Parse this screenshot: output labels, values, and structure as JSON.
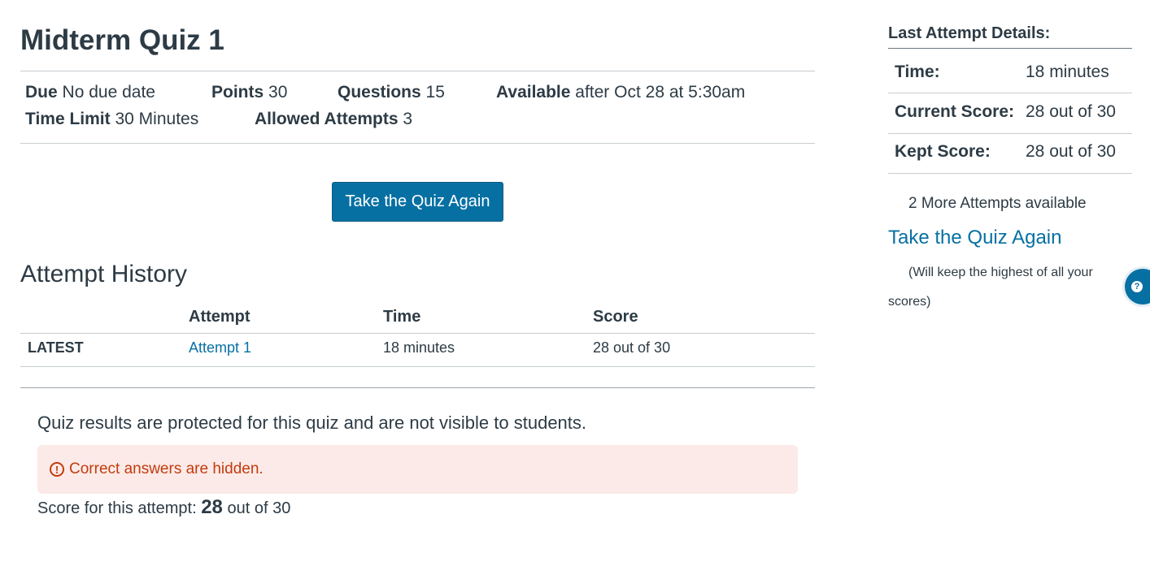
{
  "quiz": {
    "title": "Midterm Quiz 1",
    "due_label": "Due",
    "due_value": "No due date",
    "points_label": "Points",
    "points_value": "30",
    "questions_label": "Questions",
    "questions_value": "15",
    "available_label": "Available",
    "available_value": "after Oct 28 at 5:30am",
    "time_limit_label": "Time Limit",
    "time_limit_value": "30 Minutes",
    "allowed_attempts_label": "Allowed Attempts",
    "allowed_attempts_value": "3",
    "take_again_button": "Take the Quiz Again"
  },
  "attempt_history": {
    "heading": "Attempt History",
    "columns": [
      "",
      "Attempt",
      "Time",
      "Score"
    ],
    "rows": [
      {
        "tag": "LATEST",
        "attempt": "Attempt 1",
        "time": "18 minutes",
        "score": "28 out of 30"
      }
    ]
  },
  "results": {
    "protected_text": "Quiz results are protected for this quiz and are not visible to students.",
    "alert_text": "Correct answers are hidden.",
    "score_prefix": "Score for this attempt:",
    "score_value": "28",
    "score_suffix": "out of 30"
  },
  "sidebar": {
    "title": "Last Attempt Details:",
    "rows": [
      {
        "label": "Time:",
        "value": "18 minutes"
      },
      {
        "label": "Current Score:",
        "value": "28 out of 30"
      },
      {
        "label": "Kept Score:",
        "value": "28 out of 30"
      }
    ],
    "more_attempts": "2 More Attempts available",
    "take_again_link": "Take the Quiz Again",
    "keep_note": "(Will keep the highest of all your scores)"
  },
  "colors": {
    "accent": "#0770a3",
    "alert_bg": "#fbeae8",
    "alert_text": "#c23c0d",
    "text": "#2d3b45"
  },
  "icons": {
    "alert": "warning-circle-icon",
    "help": "help-icon"
  }
}
